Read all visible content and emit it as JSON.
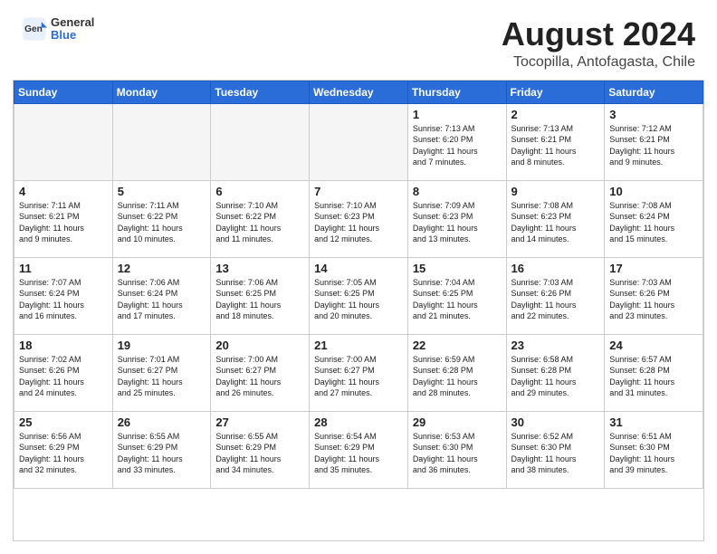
{
  "header": {
    "logo_general": "General",
    "logo_blue": "Blue",
    "month_year": "August 2024",
    "location": "Tocopilla, Antofagasta, Chile"
  },
  "days_of_week": [
    "Sunday",
    "Monday",
    "Tuesday",
    "Wednesday",
    "Thursday",
    "Friday",
    "Saturday"
  ],
  "weeks": [
    [
      {
        "day": "",
        "info": ""
      },
      {
        "day": "",
        "info": ""
      },
      {
        "day": "",
        "info": ""
      },
      {
        "day": "",
        "info": ""
      },
      {
        "day": "1",
        "info": "Sunrise: 7:13 AM\nSunset: 6:20 PM\nDaylight: 11 hours\nand 7 minutes."
      },
      {
        "day": "2",
        "info": "Sunrise: 7:13 AM\nSunset: 6:21 PM\nDaylight: 11 hours\nand 8 minutes."
      },
      {
        "day": "3",
        "info": "Sunrise: 7:12 AM\nSunset: 6:21 PM\nDaylight: 11 hours\nand 9 minutes."
      }
    ],
    [
      {
        "day": "4",
        "info": "Sunrise: 7:11 AM\nSunset: 6:21 PM\nDaylight: 11 hours\nand 9 minutes."
      },
      {
        "day": "5",
        "info": "Sunrise: 7:11 AM\nSunset: 6:22 PM\nDaylight: 11 hours\nand 10 minutes."
      },
      {
        "day": "6",
        "info": "Sunrise: 7:10 AM\nSunset: 6:22 PM\nDaylight: 11 hours\nand 11 minutes."
      },
      {
        "day": "7",
        "info": "Sunrise: 7:10 AM\nSunset: 6:23 PM\nDaylight: 11 hours\nand 12 minutes."
      },
      {
        "day": "8",
        "info": "Sunrise: 7:09 AM\nSunset: 6:23 PM\nDaylight: 11 hours\nand 13 minutes."
      },
      {
        "day": "9",
        "info": "Sunrise: 7:08 AM\nSunset: 6:23 PM\nDaylight: 11 hours\nand 14 minutes."
      },
      {
        "day": "10",
        "info": "Sunrise: 7:08 AM\nSunset: 6:24 PM\nDaylight: 11 hours\nand 15 minutes."
      }
    ],
    [
      {
        "day": "11",
        "info": "Sunrise: 7:07 AM\nSunset: 6:24 PM\nDaylight: 11 hours\nand 16 minutes."
      },
      {
        "day": "12",
        "info": "Sunrise: 7:06 AM\nSunset: 6:24 PM\nDaylight: 11 hours\nand 17 minutes."
      },
      {
        "day": "13",
        "info": "Sunrise: 7:06 AM\nSunset: 6:25 PM\nDaylight: 11 hours\nand 18 minutes."
      },
      {
        "day": "14",
        "info": "Sunrise: 7:05 AM\nSunset: 6:25 PM\nDaylight: 11 hours\nand 20 minutes."
      },
      {
        "day": "15",
        "info": "Sunrise: 7:04 AM\nSunset: 6:25 PM\nDaylight: 11 hours\nand 21 minutes."
      },
      {
        "day": "16",
        "info": "Sunrise: 7:03 AM\nSunset: 6:26 PM\nDaylight: 11 hours\nand 22 minutes."
      },
      {
        "day": "17",
        "info": "Sunrise: 7:03 AM\nSunset: 6:26 PM\nDaylight: 11 hours\nand 23 minutes."
      }
    ],
    [
      {
        "day": "18",
        "info": "Sunrise: 7:02 AM\nSunset: 6:26 PM\nDaylight: 11 hours\nand 24 minutes."
      },
      {
        "day": "19",
        "info": "Sunrise: 7:01 AM\nSunset: 6:27 PM\nDaylight: 11 hours\nand 25 minutes."
      },
      {
        "day": "20",
        "info": "Sunrise: 7:00 AM\nSunset: 6:27 PM\nDaylight: 11 hours\nand 26 minutes."
      },
      {
        "day": "21",
        "info": "Sunrise: 7:00 AM\nSunset: 6:27 PM\nDaylight: 11 hours\nand 27 minutes."
      },
      {
        "day": "22",
        "info": "Sunrise: 6:59 AM\nSunset: 6:28 PM\nDaylight: 11 hours\nand 28 minutes."
      },
      {
        "day": "23",
        "info": "Sunrise: 6:58 AM\nSunset: 6:28 PM\nDaylight: 11 hours\nand 29 minutes."
      },
      {
        "day": "24",
        "info": "Sunrise: 6:57 AM\nSunset: 6:28 PM\nDaylight: 11 hours\nand 31 minutes."
      }
    ],
    [
      {
        "day": "25",
        "info": "Sunrise: 6:56 AM\nSunset: 6:29 PM\nDaylight: 11 hours\nand 32 minutes."
      },
      {
        "day": "26",
        "info": "Sunrise: 6:55 AM\nSunset: 6:29 PM\nDaylight: 11 hours\nand 33 minutes."
      },
      {
        "day": "27",
        "info": "Sunrise: 6:55 AM\nSunset: 6:29 PM\nDaylight: 11 hours\nand 34 minutes."
      },
      {
        "day": "28",
        "info": "Sunrise: 6:54 AM\nSunset: 6:29 PM\nDaylight: 11 hours\nand 35 minutes."
      },
      {
        "day": "29",
        "info": "Sunrise: 6:53 AM\nSunset: 6:30 PM\nDaylight: 11 hours\nand 36 minutes."
      },
      {
        "day": "30",
        "info": "Sunrise: 6:52 AM\nSunset: 6:30 PM\nDaylight: 11 hours\nand 38 minutes."
      },
      {
        "day": "31",
        "info": "Sunrise: 6:51 AM\nSunset: 6:30 PM\nDaylight: 11 hours\nand 39 minutes."
      }
    ]
  ]
}
